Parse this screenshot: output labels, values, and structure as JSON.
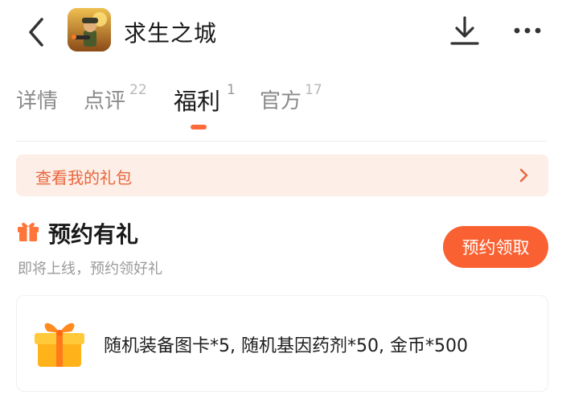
{
  "header": {
    "app_name": "求生之城",
    "back_icon": "chevron-left-icon",
    "download_icon": "download-icon",
    "more_icon": "more-dots-icon"
  },
  "tabs": [
    {
      "label": "详情",
      "count": ""
    },
    {
      "label": "点评",
      "count": "22"
    },
    {
      "label": "福利",
      "count": "1",
      "active": true
    },
    {
      "label": "官方",
      "count": "17"
    }
  ],
  "gift_bar": {
    "label": "查看我的礼包",
    "accent": "#e8663c",
    "background": "#fdeee7"
  },
  "section": {
    "title": "预约有礼",
    "subtitle": "即将上线，预约领好礼",
    "button_label": "预约领取",
    "button_color": "#fa6132"
  },
  "reward": {
    "text": "随机装备图卡*5, 随机基因药剂*50, 金币*500",
    "icon": "gift-box-icon"
  }
}
